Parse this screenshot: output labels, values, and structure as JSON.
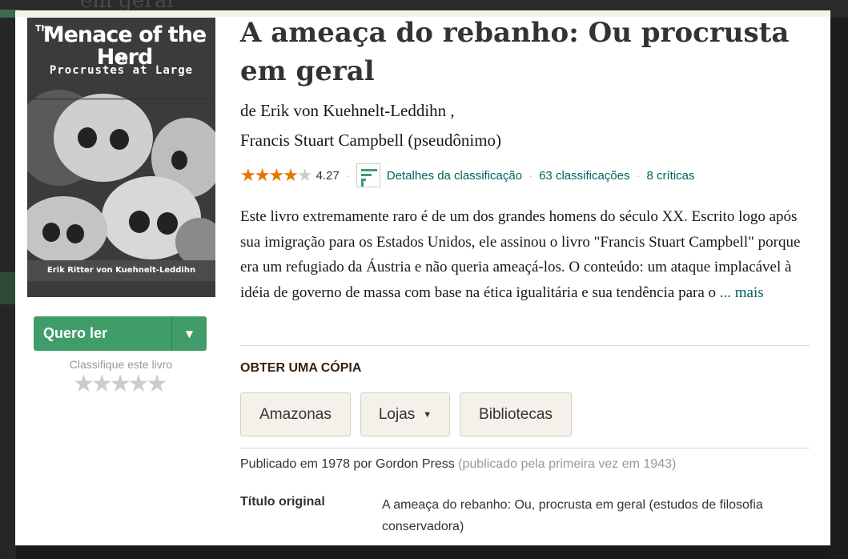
{
  "background": {
    "faded_title": "em geral"
  },
  "cover": {
    "title_the": "The",
    "title_main": "Menace of the Herd",
    "title_or": "OR",
    "title_sub": "Procrustes at Large",
    "author": "Erik Ritter von Kuehnelt-Leddihn"
  },
  "want_to_read": {
    "label": "Quero ler",
    "caret": "▼"
  },
  "rate_this": {
    "label": "Classifique este livro",
    "stars": "★★★★★"
  },
  "book": {
    "title": "A ameaça do rebanho: Ou procrusta em geral",
    "author_line_1": "de Erik von Kuehnelt-Leddihn ,",
    "author_line_2": "Francis Stuart Campbell (pseudônimo)",
    "average_rating": "4.27",
    "rating_value": 4.27,
    "rating_details_label": "Detalhes da classificação",
    "ratings_count": "63 classificações",
    "reviews_count": "8 críticas",
    "description": "Este livro extremamente raro é de um dos grandes homens do século XX. Escrito logo após sua imigração para os Estados Unidos, ele assinou o livro \"Francis Stuart Campbell\" porque era um refugiado da Áustria e não queria ameaçá-los. O conteúdo: um ataque implacável à idéia de governo de massa com base na ética igualitária e sua tendência para o",
    "more_link": "... mais"
  },
  "get_a_copy": {
    "heading": "OBTER UMA CÓPIA",
    "buttons": [
      "Amazonas",
      "Lojas",
      "Bibliotecas"
    ],
    "caret": "▼"
  },
  "details": {
    "published": "Publicado em 1978 por Gordon Press",
    "first_published": "(publicado pela primeira vez em 1943)",
    "original_title_label": "Título original",
    "original_title_value": "A ameaça do rebanho: Ou, procrusta em geral (estudos de filosofia conservadora)"
  },
  "colors": {
    "green_button": "#409d69",
    "link": "#00635d",
    "star": "#e87400"
  }
}
